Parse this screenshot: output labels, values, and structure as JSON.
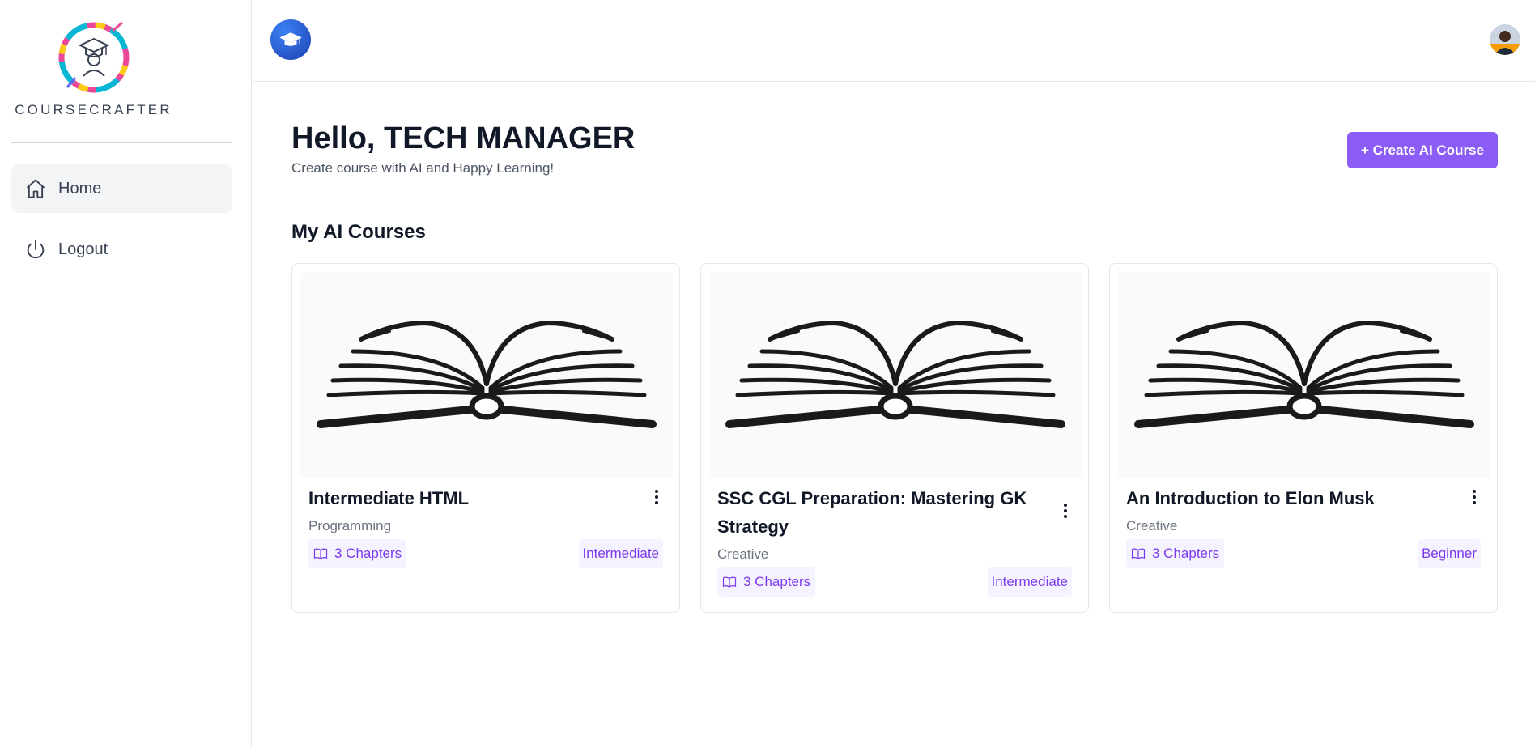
{
  "sidebar": {
    "brand": "COURSECRAFTER",
    "logo_icon": "graduate-logo-icon",
    "items": [
      {
        "label": "Home",
        "icon": "home-icon",
        "active": true
      },
      {
        "label": "Logout",
        "icon": "power-icon",
        "active": false
      }
    ]
  },
  "header": {
    "logo_icon": "graduation-cap-icon",
    "avatar": "user-avatar"
  },
  "main": {
    "greeting_prefix": "Hello,",
    "user_name": "TECH MANAGER",
    "subtitle": "Create course with AI and Happy Learning!",
    "create_button": "+ Create AI Course",
    "section_title": "My AI Courses",
    "accent_color": "#8b5cf6",
    "courses": [
      {
        "title": "Intermediate HTML",
        "category": "Programming",
        "chapters": "3 Chapters",
        "level": "Intermediate",
        "image_icon": "open-book-icon"
      },
      {
        "title": "SSC CGL Preparation: Mastering GK Strategy",
        "category": "Creative",
        "chapters": "3 Chapters",
        "level": "Intermediate",
        "image_icon": "open-book-icon"
      },
      {
        "title": "An Introduction to Elon Musk",
        "category": "Creative",
        "chapters": "3 Chapters",
        "level": "Beginner",
        "image_icon": "open-book-icon"
      }
    ]
  }
}
